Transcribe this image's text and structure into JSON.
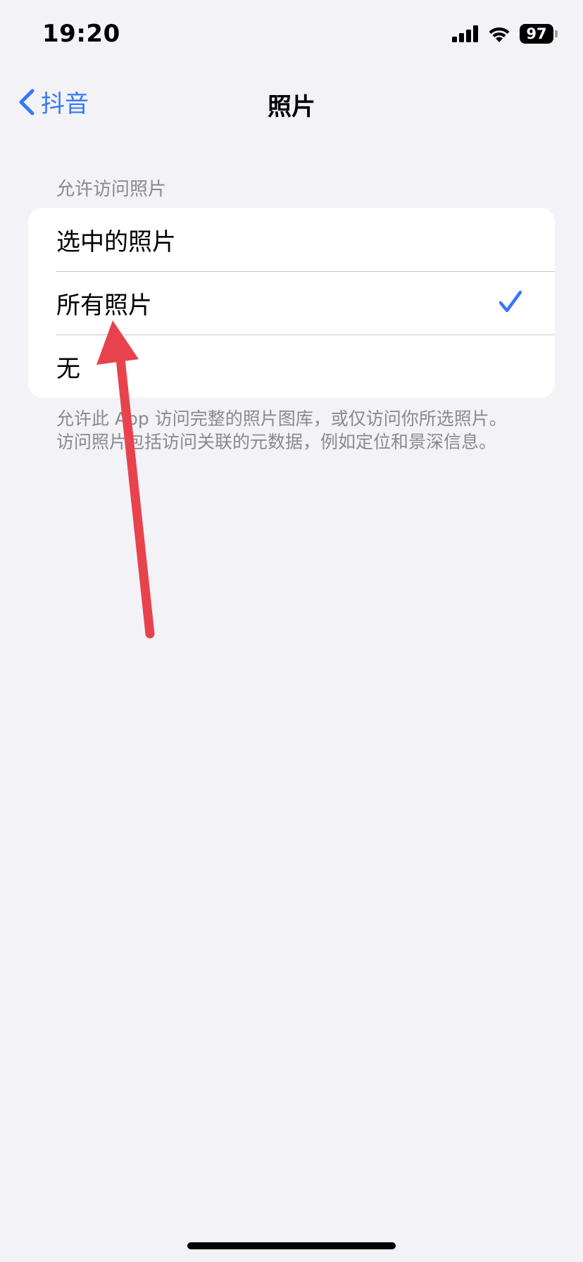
{
  "status_bar": {
    "time": "19:20",
    "battery_level": "97",
    "icons": [
      "cellular-signal-icon",
      "wifi-icon",
      "battery-icon"
    ]
  },
  "nav": {
    "back_label": "抖音",
    "title": "照片"
  },
  "photo_access": {
    "header": "允许访问照片",
    "options": [
      {
        "label": "选中的照片",
        "selected": false
      },
      {
        "label": "所有照片",
        "selected": true
      },
      {
        "label": "无",
        "selected": false
      }
    ],
    "footer_line1": "允许此 App 访问完整的照片图库，或仅访问你所选照片。",
    "footer_line2": "访问照片包括访问关联的元数据，例如定位和景深信息。"
  },
  "colors": {
    "accent": "#3478f6",
    "background": "#f2f2f7",
    "annotation": "#e8434d"
  }
}
